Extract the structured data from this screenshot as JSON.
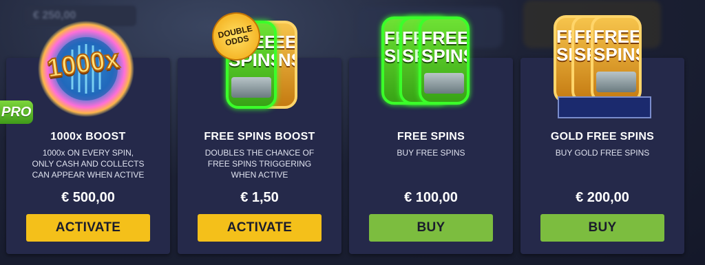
{
  "background": {
    "balance_text": "€ 250,00"
  },
  "pro_tag": "PRO",
  "badge_double_odds": "DOUBLE ODDS",
  "icons": {
    "boost_label": "1000x",
    "free_spins_label": "FREE SPINS"
  },
  "cards": [
    {
      "title": "1000x BOOST",
      "description": "1000x ON EVERY SPIN,\nONLY CASH AND COLLECTS\nCAN APPEAR WHEN ACTIVE",
      "price": "€ 500,00",
      "button": "ACTIVATE",
      "button_color": "#f4c01a"
    },
    {
      "title": "FREE SPINS BOOST",
      "description": "DOUBLES THE CHANCE OF\nFREE SPINS TRIGGERING\nWHEN ACTIVE",
      "price": "€ 1,50",
      "button": "ACTIVATE",
      "button_color": "#f4c01a"
    },
    {
      "title": "FREE SPINS",
      "description": "BUY FREE SPINS",
      "price": "€ 100,00",
      "button": "BUY",
      "button_color": "#7cbd3f"
    },
    {
      "title": "GOLD FREE SPINS",
      "description": "BUY GOLD FREE SPINS",
      "price": "€ 200,00",
      "button": "BUY",
      "button_color": "#7cbd3f"
    }
  ]
}
